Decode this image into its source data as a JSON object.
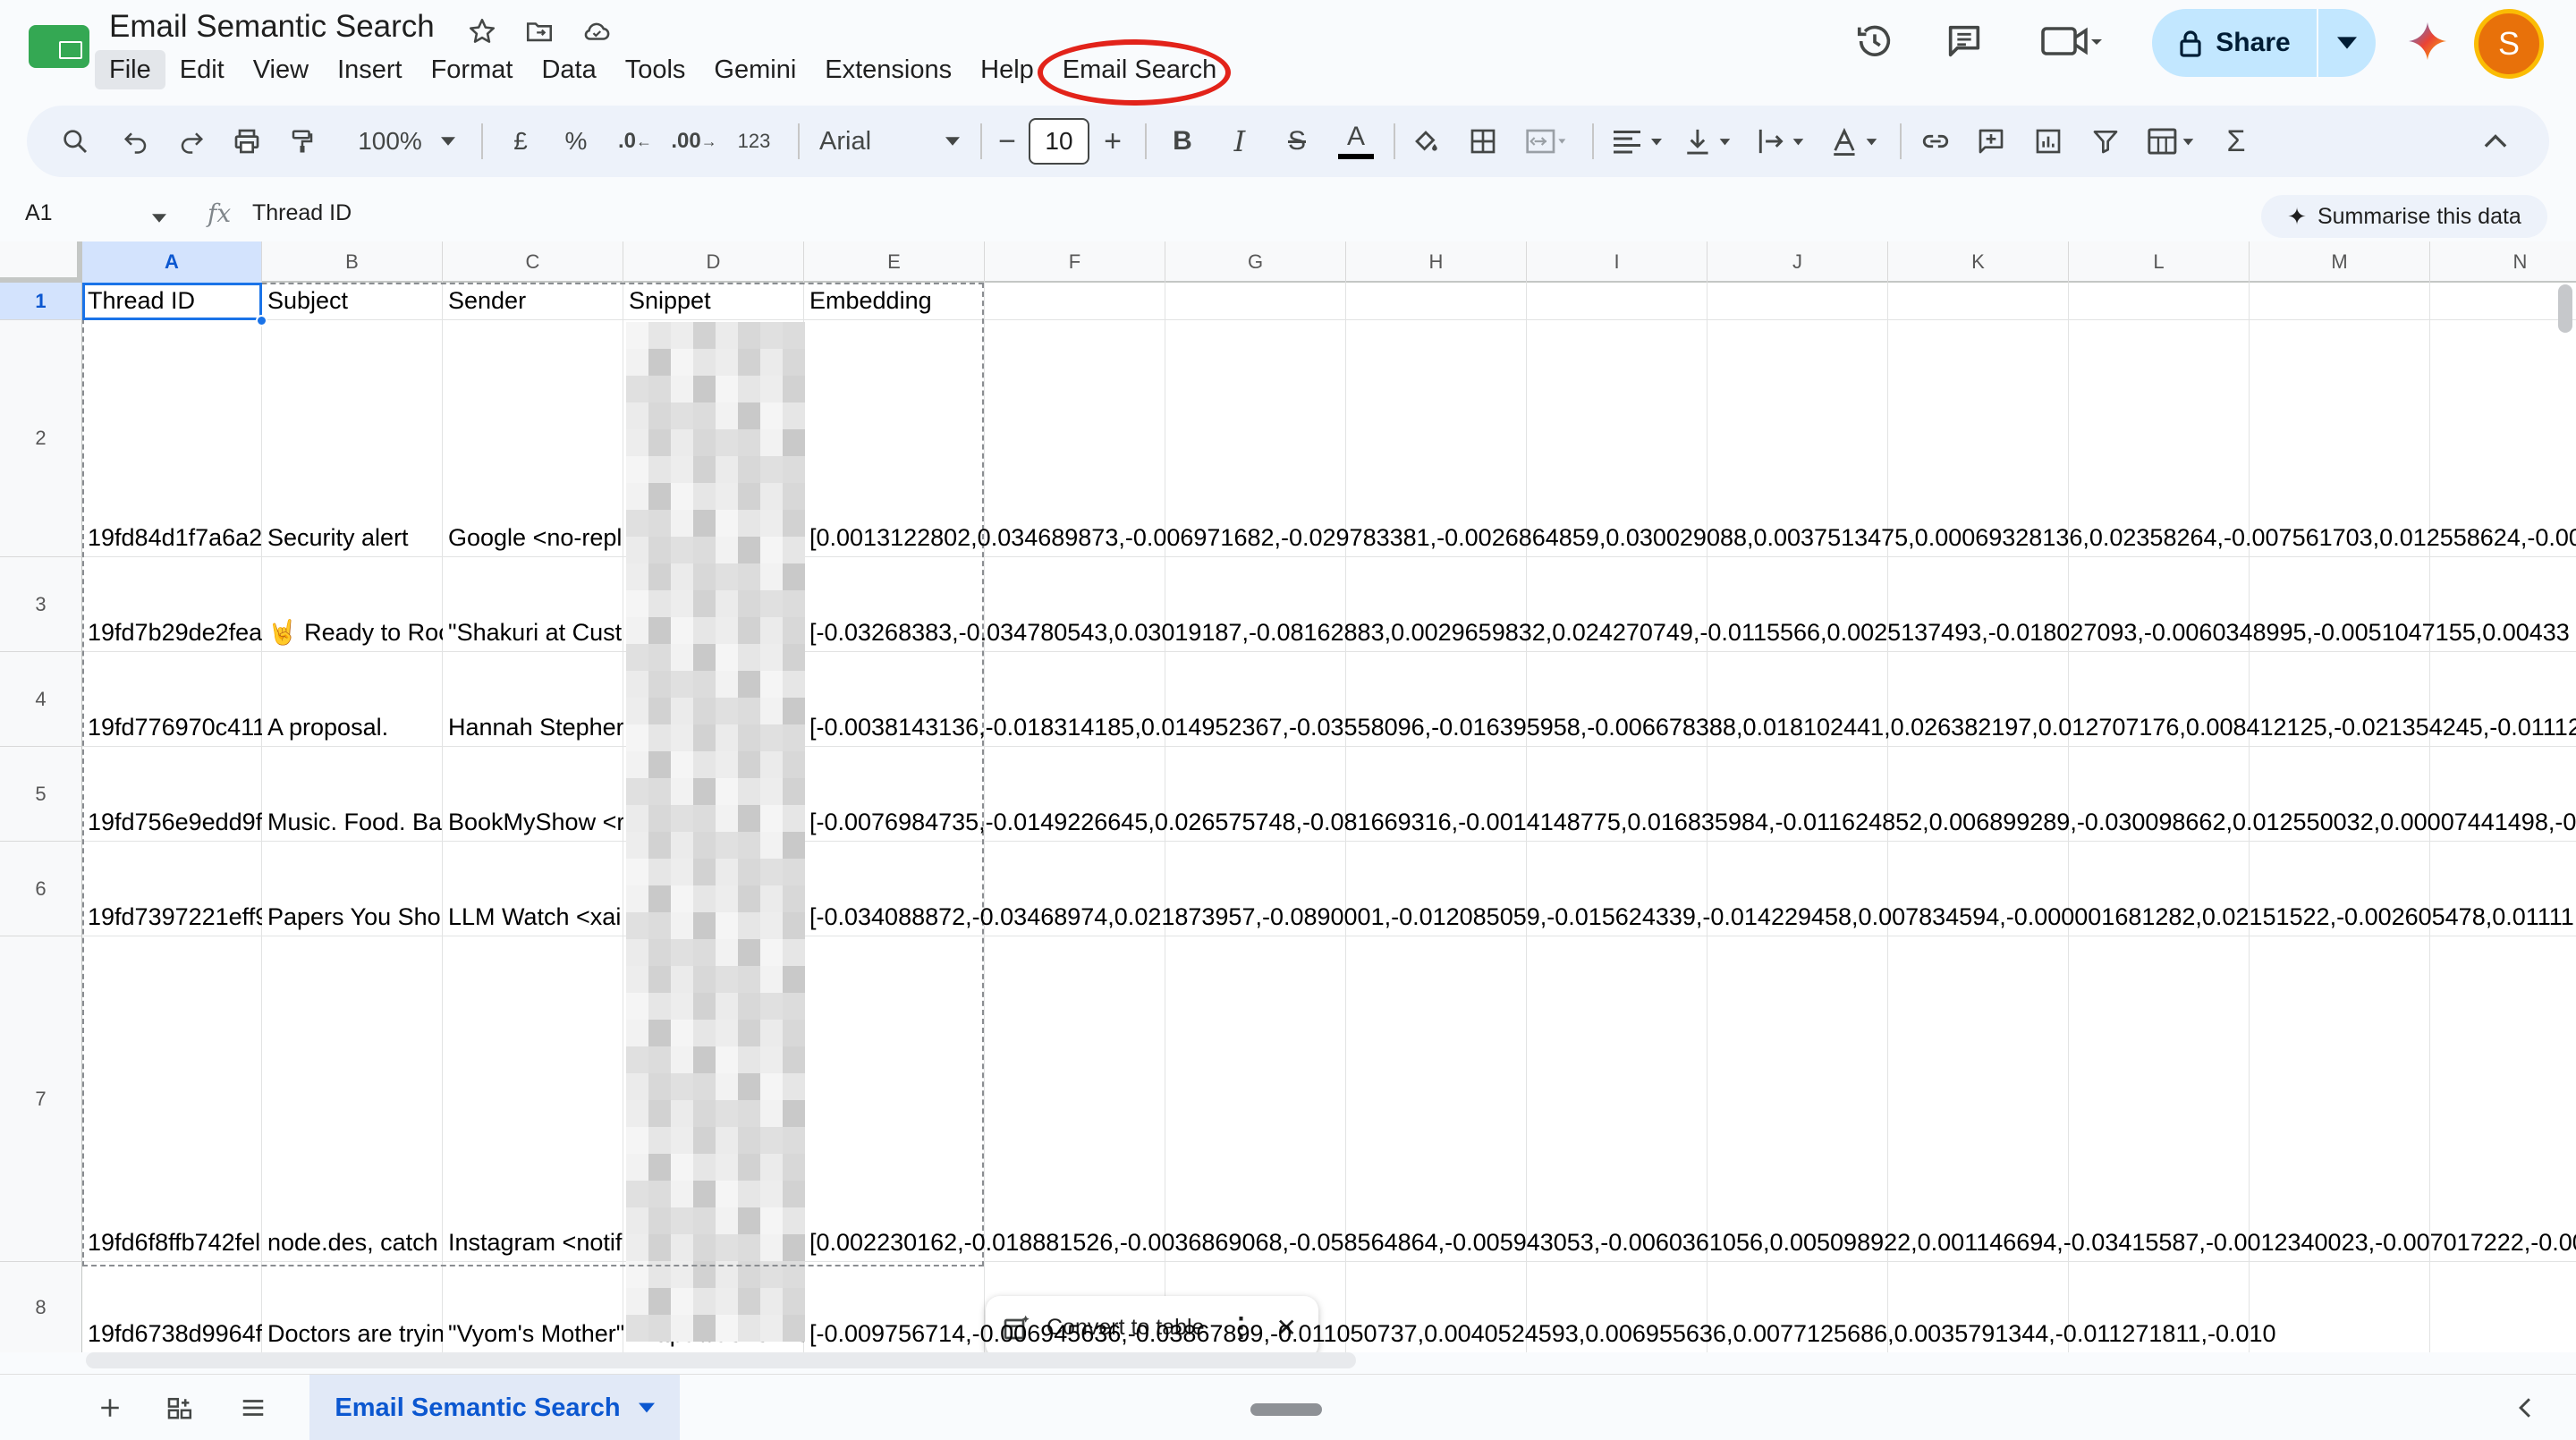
{
  "document": {
    "title": "Email Semantic Search"
  },
  "menu": [
    "File",
    "Edit",
    "View",
    "Insert",
    "Format",
    "Data",
    "Tools",
    "Gemini",
    "Extensions",
    "Help",
    "Email Search"
  ],
  "header": {
    "share_label": "Share",
    "avatar_initial": "S"
  },
  "toolbar": {
    "zoom": "100%",
    "currency": "£",
    "percent": "%",
    "decimal_decrease": ".0",
    "decimal_increase": ".00",
    "number_format": "123",
    "font": "Arial",
    "font_size": "10"
  },
  "formula_bar": {
    "cell_ref": "A1",
    "content": "Thread ID",
    "summarise_label": "Summarise this data"
  },
  "columns": [
    "A",
    "B",
    "C",
    "D",
    "E",
    "F",
    "G",
    "H",
    "I",
    "J",
    "K",
    "L",
    "M",
    "N"
  ],
  "rows": [
    {
      "num": "1",
      "cells": [
        "Thread ID",
        "Subject",
        "Sender",
        "Snippet",
        "Embedding"
      ]
    },
    {
      "num": "2",
      "cells": [
        "19fd84d1f7a6a2",
        "Security alert",
        "Google <no-repl",
        "",
        "[0.0013122802,0.034689873,-0.006971682,-0.029783381,-0.0026864859,0.030029088,0.0037513475,0.00069328136,0.02358264,-0.007561703,0.012558624,-0.00"
      ]
    },
    {
      "num": "3",
      "cells": [
        "19fd7b29de2fea",
        "🤘 Ready to Roc",
        "\"Shakuri at Cust",
        "",
        "[-0.03268383,-0.034780543,0.03019187,-0.08162883,0.0029659832,0.024270749,-0.0115566,0.0025137493,-0.018027093,-0.0060348995,-0.0051047155,0.00433"
      ]
    },
    {
      "num": "4",
      "cells": [
        "19fd776970c411",
        "A proposal.",
        "Hannah Stepher",
        "",
        "[-0.0038143136,-0.018314185,0.014952367,-0.03558096,-0.016395958,-0.006678388,0.018102441,0.026382197,0.012707176,0.008412125,-0.021354245,-0.01112"
      ]
    },
    {
      "num": "5",
      "cells": [
        "19fd756e9edd9f",
        "Music. Food. Ba",
        "BookMyShow <r",
        "",
        "[-0.0076984735,-0.0149226645,0.026575748,-0.081669316,-0.0014148775,0.016835984,-0.011624852,0.006899289,-0.030098662,0.012550032,0.00007441498,-0"
      ]
    },
    {
      "num": "6",
      "cells": [
        "19fd7397221eff9",
        "Papers You Sho",
        "LLM Watch <xai",
        "",
        "[-0.034088872,-0.03468974,0.021873957,-0.0890001,-0.012085059,-0.015624339,-0.014229458,0.007834594,-0.000001681282,0.02151522,-0.002605478,0.01111"
      ]
    },
    {
      "num": "7",
      "cells": [
        "19fd6f8ffb742fel",
        "node.des, catch",
        "Instagram <notif",
        "",
        "[0.002230162,-0.018881526,-0.0036869068,-0.058564864,-0.005943053,-0.0060361056,0.005098922,0.001146694,-0.03415587,-0.0012340023,-0.007017222,-0.00"
      ]
    },
    {
      "num": "8",
      "cells": [
        "19fd6738d9964f",
        "Doctors are tryin",
        "\"Vyom's Mother\"",
        "<https://u373723",
        "[-0.009756714,-0.006945636,-0.03867899,-0.011050737,0.0040524593,0.006955636,0.0077125686,0.0035791344,-0.011271811,-0.010"
      ]
    }
  ],
  "toast": {
    "label": "Convert to table"
  },
  "sheet": {
    "tab_label": "Email Semantic Search"
  }
}
